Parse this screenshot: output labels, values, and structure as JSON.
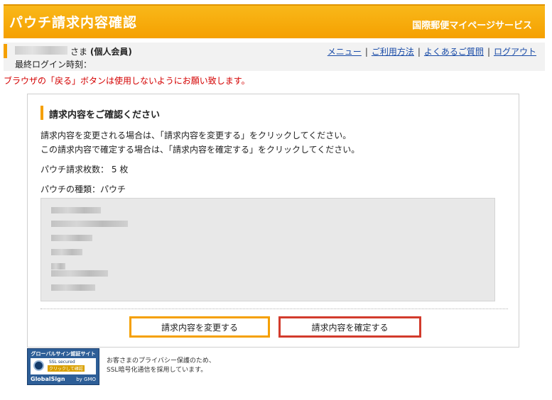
{
  "header": {
    "title": "パウチ請求内容確認",
    "service": "国際郵便マイページサービス"
  },
  "user": {
    "suffix": "さま",
    "member_type": "(個人会員)",
    "last_login_label": "最終ログイン時刻："
  },
  "nav": {
    "menu": "メニュー",
    "usage": "ご利用方法",
    "faq": "よくあるご質問",
    "logout": "ログアウト",
    "separator": "|"
  },
  "warning": "ブラウザの「戻る」ボタンは使用しないようにお願い致します。",
  "panel": {
    "heading": "請求内容をご確認ください",
    "instruction_1": "請求内容を変更される場合は、「請求内容を変更する」をクリックしてください。",
    "instruction_2": "この請求内容で確定する場合は、「請求内容を確定する」をクリックしてください。",
    "count_label": "パウチ請求枚数：",
    "count_value": "5",
    "count_unit": "枚",
    "type_label": "パウチの種類：",
    "type_value": "パウチ"
  },
  "buttons": {
    "change": "請求内容を変更する",
    "confirm": "請求内容を確定する"
  },
  "seal": {
    "title": "グローバルサイン認証サイト",
    "ssl": "SSL secured",
    "click": "クリックして確認",
    "brand": "GlobalSign",
    "by": "by GMO"
  },
  "seal_text": {
    "line1": "お客さまのプライバシー保護のため、",
    "line2": "SSL暗号化通信を採用しています。"
  },
  "colors": {
    "brand_orange": "#f5a000",
    "warning_red": "#d40000",
    "confirm_border": "#d23b2c",
    "link_blue": "#1a4ca8"
  }
}
